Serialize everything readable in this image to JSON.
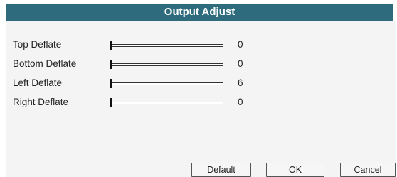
{
  "dialog": {
    "title": "Output Adjust"
  },
  "rows": [
    {
      "label": "Top Deflate",
      "value": "0",
      "slider_fraction": 0.0
    },
    {
      "label": "Bottom Deflate",
      "value": "0",
      "slider_fraction": 0.0
    },
    {
      "label": "Left Deflate",
      "value": "6",
      "slider_fraction": 0.0
    },
    {
      "label": "Right Deflate",
      "value": "0",
      "slider_fraction": 0.0
    }
  ],
  "buttons": {
    "default_label": "Default",
    "ok_label": "OK",
    "cancel_label": "Cancel"
  },
  "colors": {
    "titlebar": "#2e6b7c",
    "body": "#f4f4f4",
    "thumb": "#111111"
  }
}
